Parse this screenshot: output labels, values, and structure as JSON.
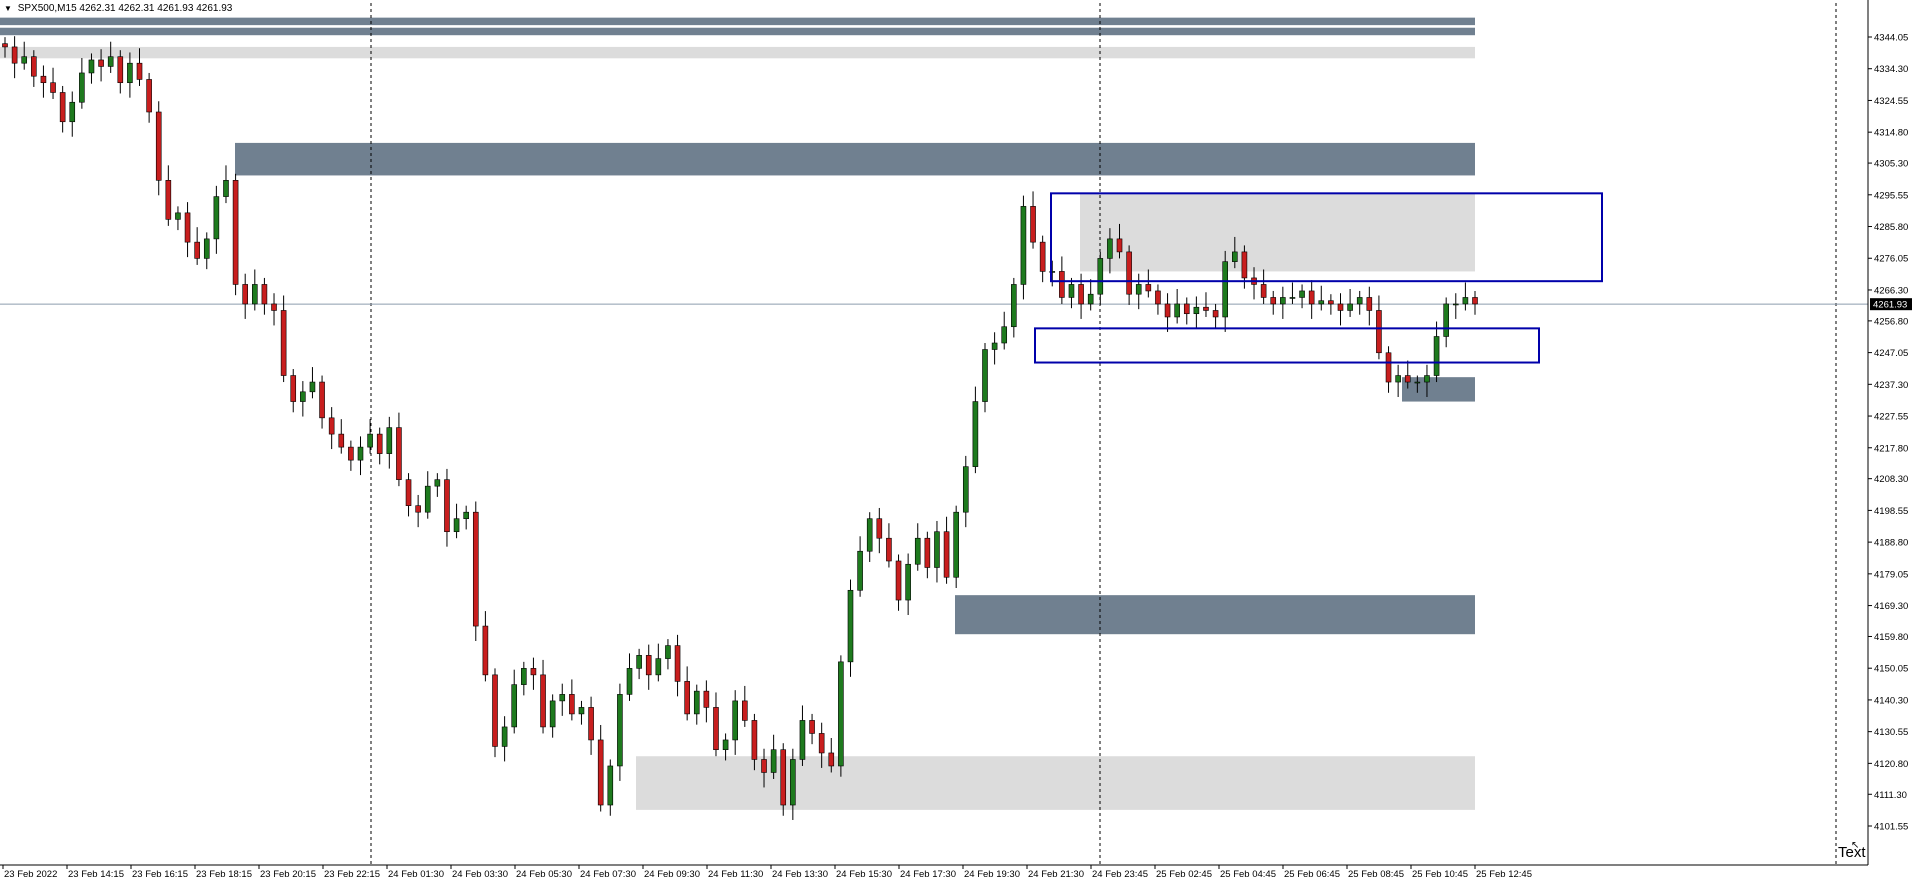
{
  "header": {
    "symbol": "SPX500,M15",
    "ohlc": "4262.31 4262.31 4261.93 4261.93"
  },
  "corner_text": "Text",
  "colors": {
    "background": "#ffffff",
    "bull": "#1e7a1e",
    "bear": "#c81e1e",
    "wick": "#000000",
    "supply_zone": "#708090",
    "demand_zone": "#dcdcdc",
    "rect_outline": "#0000aa",
    "price_line": "#8c9cae",
    "grid_vline": "#000000"
  },
  "chart_data": {
    "type": "candlestick",
    "title": "",
    "xlabel": "",
    "ylabel": "",
    "ylim": [
      4101.55,
      4344.05
    ],
    "last_price": "4261.93",
    "y_ticks": [
      "4344.05",
      "4334.30",
      "4324.55",
      "4314.80",
      "4305.30",
      "4295.55",
      "4285.80",
      "4276.05",
      "4266.30",
      "4256.80",
      "4247.05",
      "4237.30",
      "4227.55",
      "4217.80",
      "4208.30",
      "4198.55",
      "4188.80",
      "4179.05",
      "4169.30",
      "4159.80",
      "4150.05",
      "4140.30",
      "4130.55",
      "4120.80",
      "4111.30",
      "4101.55"
    ],
    "x_ticks": [
      "23 Feb 2022",
      "23 Feb 14:15",
      "23 Feb 16:15",
      "23 Feb 18:15",
      "23 Feb 20:15",
      "23 Feb 22:15",
      "24 Feb 01:30",
      "24 Feb 03:30",
      "24 Feb 05:30",
      "24 Feb 07:30",
      "24 Feb 09:30",
      "24 Feb 11:30",
      "24 Feb 13:30",
      "24 Feb 15:30",
      "24 Feb 17:30",
      "24 Feb 19:30",
      "24 Feb 21:30",
      "24 Feb 23:45",
      "25 Feb 02:45",
      "25 Feb 04:45",
      "25 Feb 06:45",
      "25 Feb 08:45",
      "25 Feb 10:45",
      "25 Feb 12:45"
    ],
    "closes": [
      4341,
      4336,
      4338,
      4332,
      4330,
      4327,
      4318,
      4324,
      4333,
      4337,
      4335,
      4338,
      4330,
      4336,
      4331,
      4321,
      4300,
      4288,
      4290,
      4281,
      4276,
      4282,
      4295,
      4300,
      4268,
      4262,
      4268,
      4262,
      4260,
      4240,
      4232,
      4235,
      4238,
      4227,
      4222,
      4218,
      4214,
      4218,
      4222,
      4216,
      4224,
      4208,
      4200,
      4198,
      4206,
      4208,
      4192,
      4196,
      4198,
      4163,
      4148,
      4126,
      4132,
      4145,
      4150,
      4148,
      4132,
      4140,
      4142,
      4136,
      4138,
      4128,
      4108,
      4120,
      4142,
      4150,
      4154,
      4148,
      4153,
      4157,
      4146,
      4136,
      4143,
      4138,
      4125,
      4128,
      4140,
      4134,
      4122,
      4118,
      4125,
      4108,
      4122,
      4134,
      4130,
      4124,
      4120,
      4152,
      4174,
      4186,
      4196,
      4190,
      4183,
      4171,
      4182,
      4190,
      4181,
      4192,
      4178,
      4198,
      4212,
      4232,
      4248,
      4250,
      4255,
      4268,
      4292,
      4281,
      4272,
      4272,
      4264,
      4268,
      4262,
      4265,
      4276,
      4282,
      4278,
      4265,
      4268,
      4266,
      4262,
      4258,
      4262,
      4259,
      4261,
      4260,
      4258,
      4275,
      4278,
      4270,
      4268,
      4264,
      4262,
      4264,
      4264,
      4266,
      4262,
      4263,
      4262,
      4260,
      4262,
      4264,
      4260,
      4247,
      4238,
      4240,
      4238,
      4238,
      4240,
      4252,
      4262,
      4262,
      4264,
      4262
    ],
    "supply_zones": [
      {
        "y_from": 4350.0,
        "y_to": 4347.7
      },
      {
        "y_from": 4346.9,
        "y_to": 4344.6
      },
      {
        "y_from": 4311.5,
        "y_to": 4301.5
      },
      {
        "y_from": 4239.5,
        "y_to": 4232.0
      },
      {
        "y_from": 4172.5,
        "y_to": 4160.5
      }
    ],
    "demand_zones": [
      {
        "y_from": 4341.0,
        "y_to": 4337.5
      },
      {
        "y_from": 4296.0,
        "y_to": 4272.0
      },
      {
        "y_from": 4123.0,
        "y_to": 4106.5
      }
    ],
    "rectangles": [
      {
        "y_from": 4296.0,
        "y_to": 4269.0
      },
      {
        "y_from": 4254.5,
        "y_to": 4244.0
      }
    ]
  }
}
